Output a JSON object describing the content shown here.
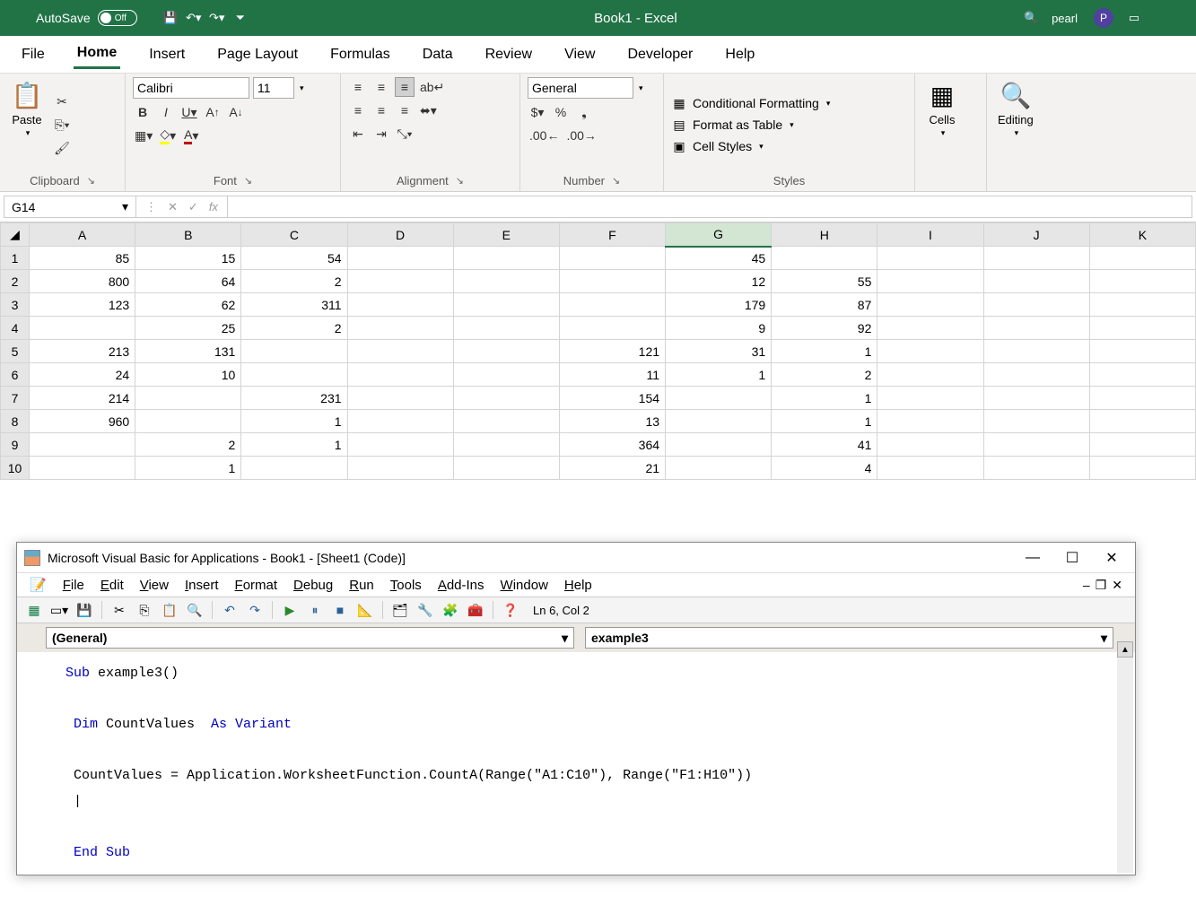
{
  "titlebar": {
    "autosave": "AutoSave",
    "toggle_state": "Off",
    "document": "Book1 - Excel",
    "user": "pearl",
    "user_initial": "P"
  },
  "tabs": [
    "File",
    "Home",
    "Insert",
    "Page Layout",
    "Formulas",
    "Data",
    "Review",
    "View",
    "Developer",
    "Help"
  ],
  "active_tab": "Home",
  "ribbon": {
    "clipboard": {
      "label": "Clipboard",
      "paste": "Paste"
    },
    "font": {
      "label": "Font",
      "name": "Calibri",
      "size": "11",
      "bold": "B",
      "italic": "I",
      "underline": "U"
    },
    "alignment": {
      "label": "Alignment"
    },
    "number": {
      "label": "Number",
      "format": "General"
    },
    "styles": {
      "label": "Styles",
      "conditional": "Conditional Formatting",
      "table": "Format as Table",
      "cell": "Cell Styles"
    },
    "cells": {
      "label": "Cells"
    },
    "editing": {
      "label": "Editing"
    }
  },
  "namebox": "G14",
  "columns": [
    "A",
    "B",
    "C",
    "D",
    "E",
    "F",
    "G",
    "H",
    "I",
    "J",
    "K"
  ],
  "rows": [
    {
      "n": 1,
      "A": "85",
      "B": "15",
      "C": "54",
      "D": "",
      "E": "",
      "F": "",
      "G": "45",
      "H": "",
      "I": "",
      "J": "",
      "K": ""
    },
    {
      "n": 2,
      "A": "800",
      "B": "64",
      "C": "2",
      "D": "",
      "E": "",
      "F": "",
      "G": "12",
      "H": "55",
      "I": "",
      "J": "",
      "K": ""
    },
    {
      "n": 3,
      "A": "123",
      "B": "62",
      "C": "311",
      "D": "",
      "E": "",
      "F": "",
      "G": "179",
      "H": "87",
      "I": "",
      "J": "",
      "K": ""
    },
    {
      "n": 4,
      "A": "",
      "B": "25",
      "C": "2",
      "D": "",
      "E": "",
      "F": "",
      "G": "9",
      "H": "92",
      "I": "",
      "J": "",
      "K": ""
    },
    {
      "n": 5,
      "A": "213",
      "B": "131",
      "C": "",
      "D": "",
      "E": "",
      "F": "121",
      "G": "31",
      "H": "1",
      "I": "",
      "J": "",
      "K": ""
    },
    {
      "n": 6,
      "A": "24",
      "B": "10",
      "C": "",
      "D": "",
      "E": "",
      "F": "11",
      "G": "1",
      "H": "2",
      "I": "",
      "J": "",
      "K": ""
    },
    {
      "n": 7,
      "A": "214",
      "B": "",
      "C": "231",
      "D": "",
      "E": "",
      "F": "154",
      "G": "",
      "H": "1",
      "I": "",
      "J": "",
      "K": ""
    },
    {
      "n": 8,
      "A": "960",
      "B": "",
      "C": "1",
      "D": "",
      "E": "",
      "F": "13",
      "G": "",
      "H": "1",
      "I": "",
      "J": "",
      "K": ""
    },
    {
      "n": 9,
      "A": "",
      "B": "2",
      "C": "1",
      "D": "",
      "E": "",
      "F": "364",
      "G": "",
      "H": "41",
      "I": "",
      "J": "",
      "K": ""
    },
    {
      "n": 10,
      "A": "",
      "B": "1",
      "C": "",
      "D": "",
      "E": "",
      "F": "21",
      "G": "",
      "H": "4",
      "I": "",
      "J": "",
      "K": ""
    }
  ],
  "vba": {
    "title": "Microsoft Visual Basic for Applications - Book1 - [Sheet1 (Code)]",
    "menus": [
      "File",
      "Edit",
      "View",
      "Insert",
      "Format",
      "Debug",
      "Run",
      "Tools",
      "Add-Ins",
      "Window",
      "Help"
    ],
    "status": "Ln 6, Col 2",
    "left_dd": "(General)",
    "right_dd": "example3",
    "code_lines": [
      {
        "t": "kw",
        "s": "Sub "
      },
      {
        "t": "",
        "s": "example3()"
      },
      {
        "t": "br"
      },
      {
        "t": "br"
      },
      {
        "t": "kw",
        "s": " Dim "
      },
      {
        "t": "",
        "s": "CountValues  "
      },
      {
        "t": "kw",
        "s": "As Variant"
      },
      {
        "t": "br"
      },
      {
        "t": "br"
      },
      {
        "t": "",
        "s": " CountValues = Application.WorksheetFunction.CountA(Range(\"A1:C10\"), Range(\"F1:H10\"))"
      },
      {
        "t": "br"
      },
      {
        "t": "",
        "s": " |"
      },
      {
        "t": "br"
      },
      {
        "t": "br"
      },
      {
        "t": "kw",
        "s": " End Sub"
      }
    ]
  }
}
